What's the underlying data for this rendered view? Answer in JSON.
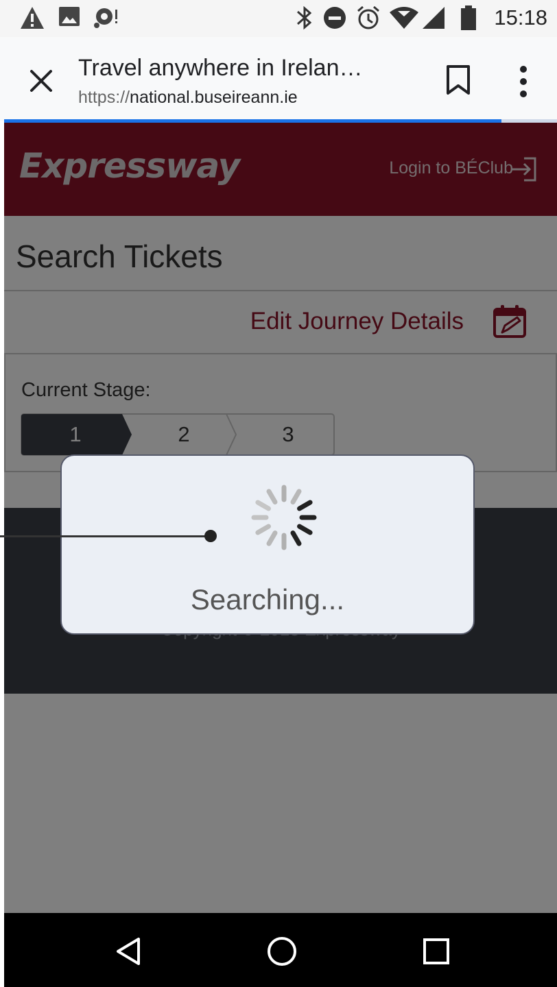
{
  "status_bar": {
    "time": "15:18",
    "left_icons": [
      "warning-icon",
      "image-icon",
      "sync-alert-icon"
    ],
    "right_icons": [
      "bluetooth-icon",
      "do-not-disturb-icon",
      "alarm-icon",
      "wifi-icon",
      "signal-icon",
      "battery-icon"
    ]
  },
  "browser": {
    "title": "Travel anywhere in Irelan…",
    "url_scheme": "https://",
    "url_host": "national.buseireann.ie",
    "progress": 0.9
  },
  "site": {
    "logo": "Expressway",
    "login_label": "Login to BÉClub",
    "page_title": "Search Tickets",
    "edit_label": "Edit Journey Details",
    "stage_label": "Current Stage:",
    "steps": [
      "1",
      "2",
      "3"
    ],
    "active_step": 1,
    "copyright": "Copyright © 2018 Expressway"
  },
  "modal": {
    "message": "Searching..."
  },
  "colors": {
    "brand": "#8a1328",
    "footer": "#3b3e46",
    "progress": "#1a73e8"
  }
}
